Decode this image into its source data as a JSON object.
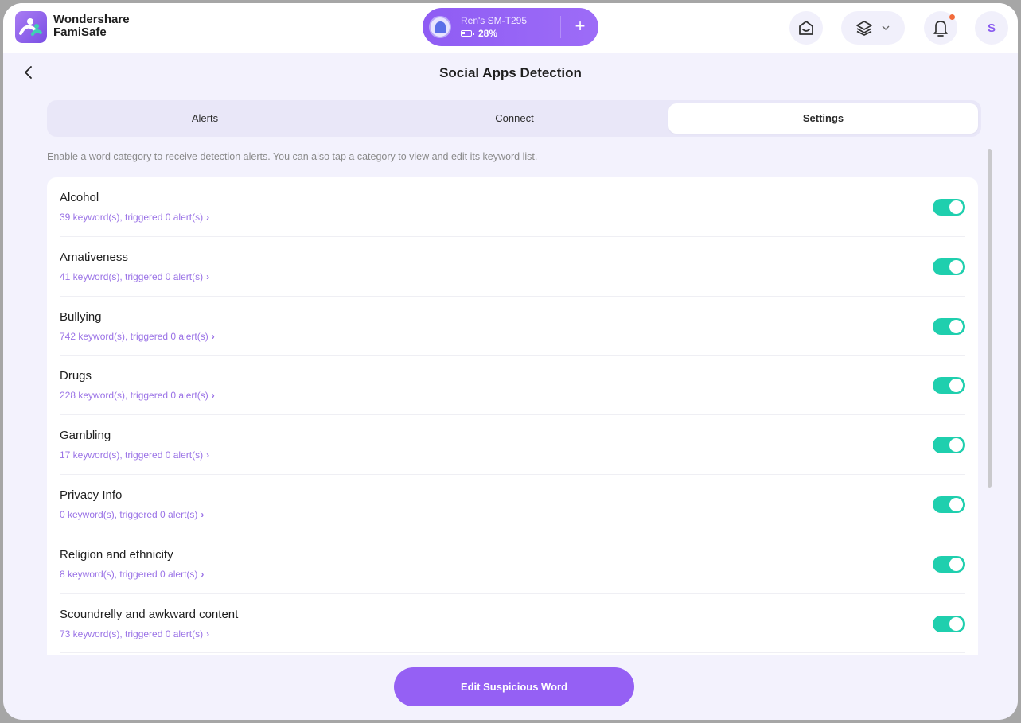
{
  "app": {
    "brand_line1": "Wondershare",
    "brand_line2": "FamiSafe"
  },
  "device": {
    "name": "Ren's SM-T295",
    "battery": "28%",
    "add_label": "+"
  },
  "topbar": {
    "avatar_initial": "S",
    "notification_dot": true
  },
  "page": {
    "title": "Social Apps Detection",
    "hint": "Enable a word category to receive detection alerts. You can also tap a category to view and edit its keyword list."
  },
  "tabs": [
    {
      "label": "Alerts",
      "active": false
    },
    {
      "label": "Connect",
      "active": false
    },
    {
      "label": "Settings",
      "active": true
    }
  ],
  "categories": [
    {
      "title": "Alcohol",
      "meta": "39 keyword(s), triggered 0 alert(s)",
      "enabled": true
    },
    {
      "title": "Amativeness",
      "meta": "41 keyword(s), triggered 0 alert(s)",
      "enabled": true
    },
    {
      "title": "Bullying",
      "meta": "742 keyword(s), triggered 0 alert(s)",
      "enabled": true
    },
    {
      "title": "Drugs",
      "meta": "228 keyword(s), triggered 0 alert(s)",
      "enabled": true
    },
    {
      "title": "Gambling",
      "meta": "17 keyword(s), triggered 0 alert(s)",
      "enabled": true
    },
    {
      "title": "Privacy Info",
      "meta": "0 keyword(s), triggered 0 alert(s)",
      "enabled": true
    },
    {
      "title": "Religion and ethnicity",
      "meta": "8 keyword(s), triggered 0 alert(s)",
      "enabled": true
    },
    {
      "title": "Scoundrelly and awkward content",
      "meta": "73 keyword(s), triggered 0 alert(s)",
      "enabled": true
    }
  ],
  "footer": {
    "edit_label": "Edit Suspicious Word"
  },
  "colors": {
    "accent": "#9560f4",
    "toggle_on": "#1fcfae",
    "meta_text": "#9a72e6",
    "background": "#f3f2fd"
  }
}
